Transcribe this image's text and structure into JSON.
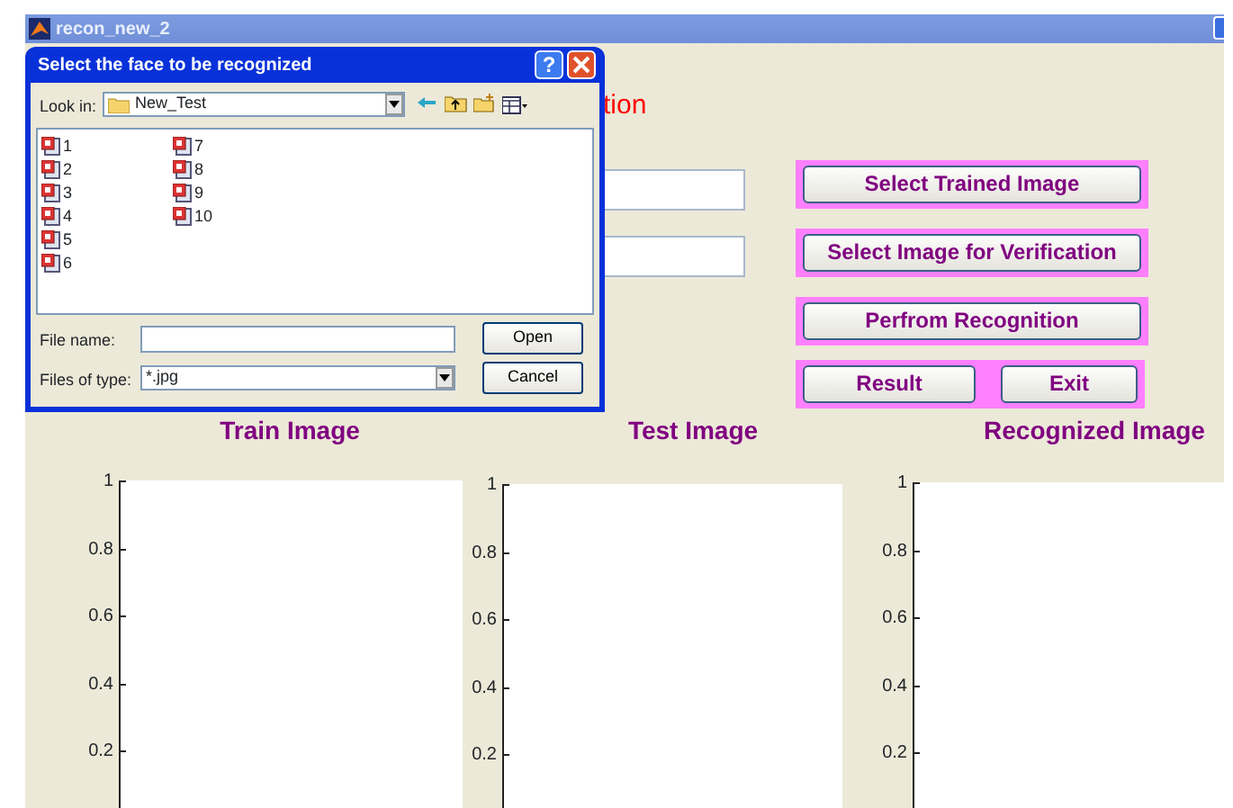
{
  "main_window": {
    "title": "recon_new_2"
  },
  "heading": "tion",
  "button_rows": [
    [
      "Select Trained Image"
    ],
    [
      "Select Image for Verification"
    ],
    [
      "Perfrom Recognition"
    ],
    [
      "Result",
      "Exit"
    ]
  ],
  "axes": [
    {
      "title": "Train Image",
      "y_tick_labels": [
        "1",
        "0.8",
        "0.6",
        "0.4",
        "0.2"
      ]
    },
    {
      "title": "Test Image",
      "y_tick_labels": [
        "1",
        "0.8",
        "0.6",
        "0.4",
        "0.2"
      ]
    },
    {
      "title": "Recognized Image",
      "y_tick_labels": [
        "1",
        "0.8",
        "0.6",
        "0.4",
        "0.2"
      ]
    }
  ],
  "dialog": {
    "title": "Select the face to be recognized",
    "help_button": "?",
    "look_in_label": "Look in:",
    "look_in_value": "New_Test",
    "files": [
      "1",
      "2",
      "3",
      "4",
      "5",
      "6",
      "7",
      "8",
      "9",
      "10"
    ],
    "file_name_label": "File name:",
    "files_of_type_label": "Files of type:",
    "files_of_type_value": "*.jpg",
    "open_button": "Open",
    "cancel_button": "Cancel"
  }
}
